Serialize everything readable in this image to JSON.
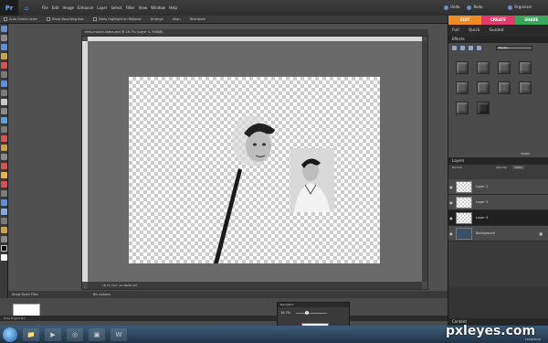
{
  "app": {
    "logo": "Pr",
    "menus": [
      "File",
      "Edit",
      "Image",
      "Enhance",
      "Layer",
      "Select",
      "Filter",
      "View",
      "Window",
      "Help"
    ],
    "undo_label": "Undo",
    "redo_label": "Redo",
    "organizer_label": "Organizer"
  },
  "options": {
    "items": [
      "Auto Select Layer",
      "Show Bounding Box",
      "Show Highlight on Rollover",
      "Arrange",
      "Align",
      "Distribute"
    ]
  },
  "document": {
    "tab_title": "elvis-morph-steps.psd @ 16.7% (Layer 4, RGB/8)",
    "status": "16.7%   Doc: 19.2M/40.2M"
  },
  "bin": {
    "show_open_files": "Show Open Files",
    "bin_actions": "Bin Actions",
    "hide_project_bin": "Hide Project Bin"
  },
  "navigator": {
    "title": "Navigator",
    "zoom": "16.7%"
  },
  "right_panel": {
    "modes": [
      {
        "label": "EDIT",
        "color": "#f08a24"
      },
      {
        "label": "CREATE",
        "color": "#e23a6b"
      },
      {
        "label": "SHARE",
        "color": "#3ba55c"
      }
    ],
    "subtabs": [
      "Full",
      "Quick",
      "Guided"
    ],
    "effects_title": "Effects",
    "effects_filter": "Bevels",
    "apply_label": "Apply",
    "layers_title": "Layers",
    "layers_normal": "Normal",
    "opacity_label": "Opacity:",
    "opacity_value": "100%",
    "layers": [
      {
        "name": "Layer 2",
        "selected": false
      },
      {
        "name": "Layer 3",
        "selected": false
      },
      {
        "name": "Layer 4",
        "selected": true
      },
      {
        "name": "Background",
        "selected": false
      }
    ],
    "content_title": "Content"
  },
  "watermark": "pxleyes.com",
  "clock": "17/06/2010",
  "colors": {
    "edit": "#f08a24",
    "create": "#e23a6b",
    "share": "#3ba55c"
  }
}
